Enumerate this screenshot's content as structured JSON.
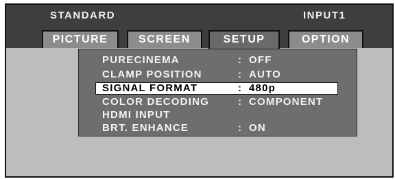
{
  "header": {
    "mode": "STANDARD",
    "input": "INPUT1"
  },
  "tabs": [
    {
      "label": "PICTURE"
    },
    {
      "label": "SCREEN"
    },
    {
      "label": "SETUP"
    },
    {
      "label": "OPTION"
    }
  ],
  "active_tab": "SETUP",
  "menu": {
    "separator": ":",
    "items": [
      {
        "label": "PURECINEMA",
        "value": "OFF"
      },
      {
        "label": "CLAMP POSITION",
        "value": "AUTO"
      },
      {
        "label": "SIGNAL FORMAT",
        "value": "480p"
      },
      {
        "label": "COLOR DECODING",
        "value": "COMPONENT"
      },
      {
        "label": "HDMI INPUT",
        "value": ""
      },
      {
        "label": "BRT. ENHANCE",
        "value": "ON"
      }
    ],
    "selected_index": 2
  },
  "colors": {
    "header_bg": "#3e3e3e",
    "screen_bg": "#bdbdbd",
    "panel_bg": "#6e6e6e",
    "tab_bg": "#8c8c8c",
    "highlight_bg": "#ffffff"
  }
}
